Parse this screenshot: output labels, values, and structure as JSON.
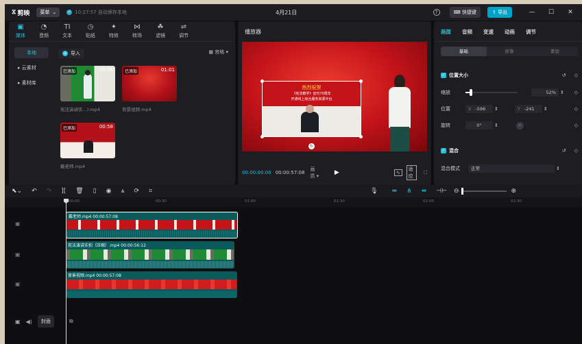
{
  "titlebar": {
    "app_name": "剪映",
    "menu_label": "菜单",
    "save_status": "10:27:57 自动保存本地",
    "doc_title": "4月21日",
    "shortcut_label": "快捷键",
    "export_label": "导出"
  },
  "media_tabs": [
    {
      "label": "媒体",
      "icon": "▣"
    },
    {
      "label": "音频",
      "icon": "◔"
    },
    {
      "label": "文本",
      "icon": "TI"
    },
    {
      "label": "贴纸",
      "icon": "◷"
    },
    {
      "label": "特效",
      "icon": "✦"
    },
    {
      "label": "转场",
      "icon": "⋈"
    },
    {
      "label": "滤镜",
      "icon": "☘"
    },
    {
      "label": "调节",
      "icon": "⇌"
    }
  ],
  "side_nav": [
    {
      "label": "本地"
    },
    {
      "label": "▸ 云素材"
    },
    {
      "label": "▸ 素材库"
    }
  ],
  "media_panel": {
    "import_label": "导入",
    "sort_label": "宫格 ▾",
    "items": [
      {
        "badge": "已添加",
        "duration": "00:56",
        "name": "宪法演讲实...).mp4"
      },
      {
        "badge": "已添加",
        "duration": "01:01",
        "name": "背景视频.mp4"
      },
      {
        "badge": "已添加",
        "duration": "00:58",
        "name": "戴老师.mp4"
      }
    ]
  },
  "player": {
    "title": "播放器",
    "current_time": "00:00:00:00",
    "total_time": "00:00:57:08",
    "quality": "画质 ▾",
    "ratio_label": "适应",
    "slide_title": "热烈祝贺",
    "slide_line1": "《宪法教学》创刊70周年",
    "slide_line2": "开通线上综合服务资源平台"
  },
  "properties": {
    "tabs": [
      "画面",
      "音频",
      "变速",
      "动画",
      "调节"
    ],
    "subtabs": [
      "基础",
      "抠像",
      "蒙版"
    ],
    "position_size_label": "位置大小",
    "scale_label": "缩放",
    "scale_value": "52%",
    "scale_level": 0.52,
    "position_label": "位置",
    "x_label": "X",
    "x_value": "-596",
    "y_label": "Y",
    "y_value": "-241",
    "rotation_label": "旋转",
    "rotation_value": "0°",
    "blend_label": "混合",
    "blend_mode_label": "混合模式",
    "blend_mode_value": "正常"
  },
  "timeline": {
    "ruler": [
      "00:00",
      "00:30",
      "01:00",
      "01:30",
      "02:00",
      "02:30"
    ],
    "cover_label": "封面",
    "tracks": [
      {
        "label": "戴老师.mp4   00:00:57:08"
      },
      {
        "label": "宪法演讲实拍（压缩）.mp4   00:00:56:12"
      },
      {
        "label": "背景视频.mp4   00:00:57:08"
      }
    ]
  },
  "colors": {
    "accent": "#24c0de",
    "bg": "#0f0f12",
    "panel": "#1d1d22",
    "red": "#c4141a"
  }
}
